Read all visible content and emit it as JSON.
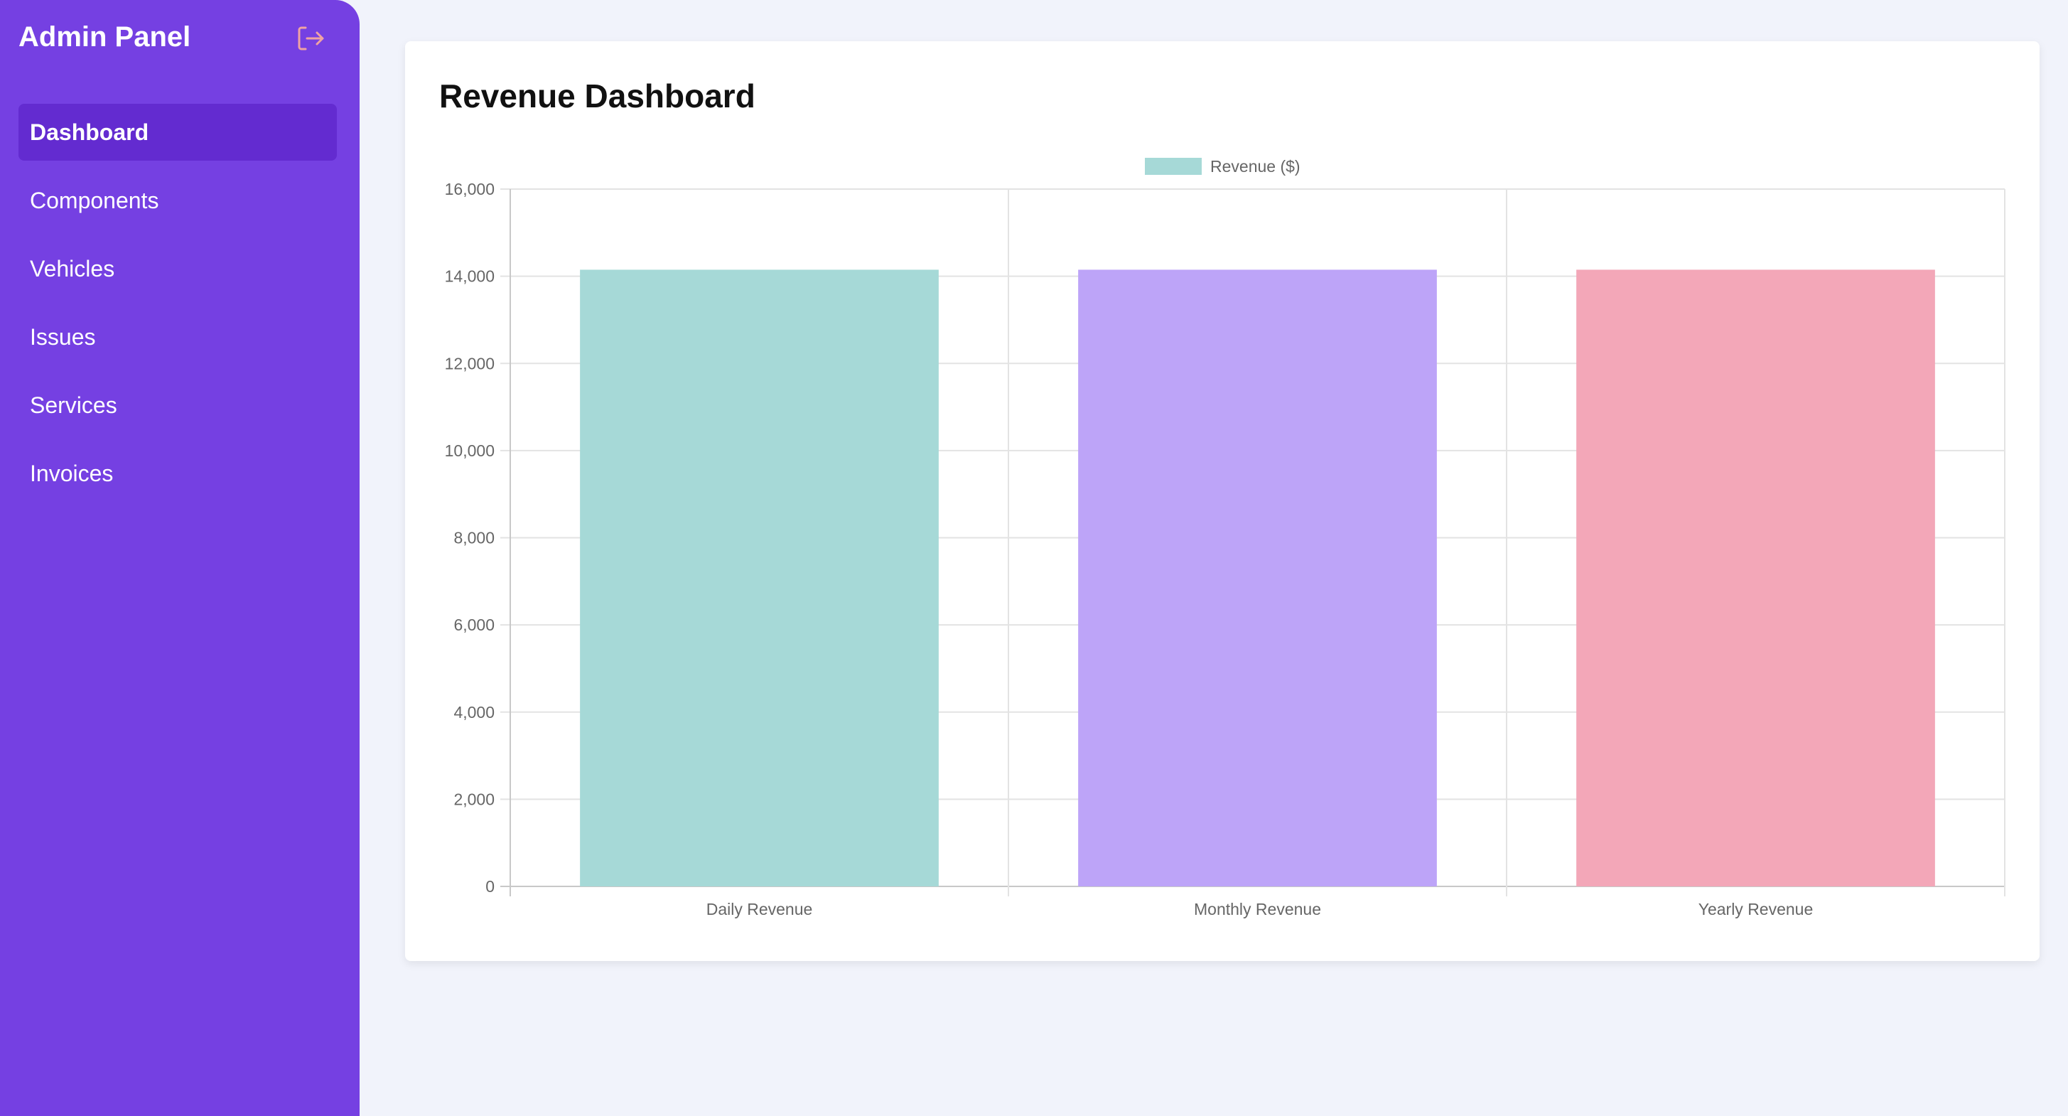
{
  "sidebar": {
    "title": "Admin Panel",
    "logout_icon": "logout-icon",
    "items": [
      {
        "label": "Dashboard",
        "active": true
      },
      {
        "label": "Components"
      },
      {
        "label": "Vehicles"
      },
      {
        "label": "Issues"
      },
      {
        "label": "Services"
      },
      {
        "label": "Invoices"
      }
    ]
  },
  "main": {
    "title": "Revenue Dashboard"
  },
  "chart_data": {
    "type": "bar",
    "categories": [
      "Daily Revenue",
      "Monthly Revenue",
      "Yearly Revenue"
    ],
    "series": [
      {
        "name": "Revenue ($)",
        "values": [
          14150,
          14150,
          14150
        ]
      }
    ],
    "colors": [
      "#a6d9d7",
      "#bda4f8",
      "#f3a7b8"
    ],
    "ylim": [
      0,
      16000
    ],
    "yticks": [
      "0",
      "2,000",
      "4,000",
      "6,000",
      "8,000",
      "10,000",
      "12,000",
      "14,000",
      "16,000"
    ],
    "grid": true,
    "legend": "top"
  }
}
